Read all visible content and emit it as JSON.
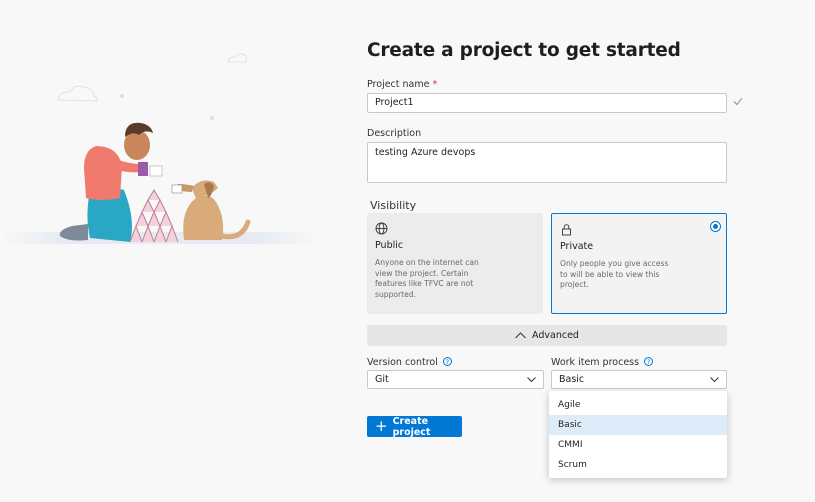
{
  "page": {
    "title": "Create a project to get started"
  },
  "form": {
    "project_name": {
      "label": "Project name",
      "required_mark": "*",
      "value": "Project1"
    },
    "description": {
      "label": "Description",
      "value": "testing Azure devops"
    },
    "visibility": {
      "label": "Visibility",
      "options": [
        {
          "title": "Public",
          "description": "Anyone on the internet can view the project. Certain features like TFVC are not supported.",
          "icon": "globe-icon",
          "selected": false
        },
        {
          "title": "Private",
          "description": "Only people you give access to will be able to view this project.",
          "icon": "lock-icon",
          "selected": true
        }
      ]
    },
    "advanced_label": "Advanced",
    "version_control": {
      "label": "Version control",
      "value": "Git"
    },
    "work_item_process": {
      "label": "Work item process",
      "value": "Basic",
      "options": [
        "Agile",
        "Basic",
        "CMMI",
        "Scrum"
      ],
      "highlighted": "Basic"
    },
    "create_button": "Create project"
  },
  "colors": {
    "accent": "#0078d4",
    "background": "#f8f8f8",
    "required": "#c4314b",
    "option_highlight": "#deecf9"
  }
}
